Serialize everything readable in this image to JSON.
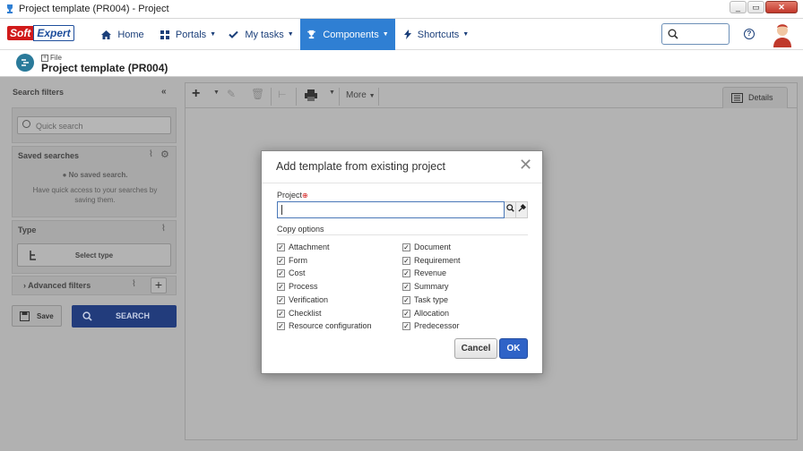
{
  "window": {
    "title": "Project template (PR004) - Project",
    "buttons": [
      "_",
      "▭",
      "✕"
    ]
  },
  "logo": {
    "part1": "Soft",
    "part2": "Expert"
  },
  "nav": [
    {
      "label": "Home",
      "icon": "home-icon"
    },
    {
      "label": "Portals",
      "icon": "grid-icon"
    },
    {
      "label": "My tasks",
      "icon": "check-icon"
    },
    {
      "label": "Components",
      "icon": "trophy-icon",
      "active": true
    },
    {
      "label": "Shortcuts",
      "icon": "bolt-icon"
    }
  ],
  "header": {
    "breadcrumb": "File",
    "title": "Project template (PR004)"
  },
  "sidebar": {
    "title": "Search filters",
    "quick_search_placeholder": "Quick search",
    "saved_searches_label": "Saved searches",
    "no_saved": "No saved search.",
    "no_saved_hint": "Have quick access to your searches by saving them.",
    "type_label": "Type",
    "select_type": "Select type",
    "advanced_filters": "Advanced filters",
    "save_label": "Save",
    "search_label": "SEARCH"
  },
  "toolbar": {
    "more_label": "More",
    "details_label": "Details"
  },
  "modal": {
    "title": "Add template from existing project",
    "project_label": "Project",
    "project_value": "",
    "copy_options_label": "Copy options",
    "options_left": [
      "Attachment",
      "Form",
      "Cost",
      "Process",
      "Verification",
      "Checklist",
      "Resource configuration"
    ],
    "options_right": [
      "Document",
      "Requirement",
      "Revenue",
      "Summary",
      "Task type",
      "Allocation",
      "Predecessor"
    ],
    "cancel_label": "Cancel",
    "ok_label": "OK"
  },
  "colors": {
    "nav_active": "#2f7fd3",
    "ok_button": "#2f63c7",
    "search_button": "#223c7c",
    "overlay": "#b1b1b1"
  }
}
